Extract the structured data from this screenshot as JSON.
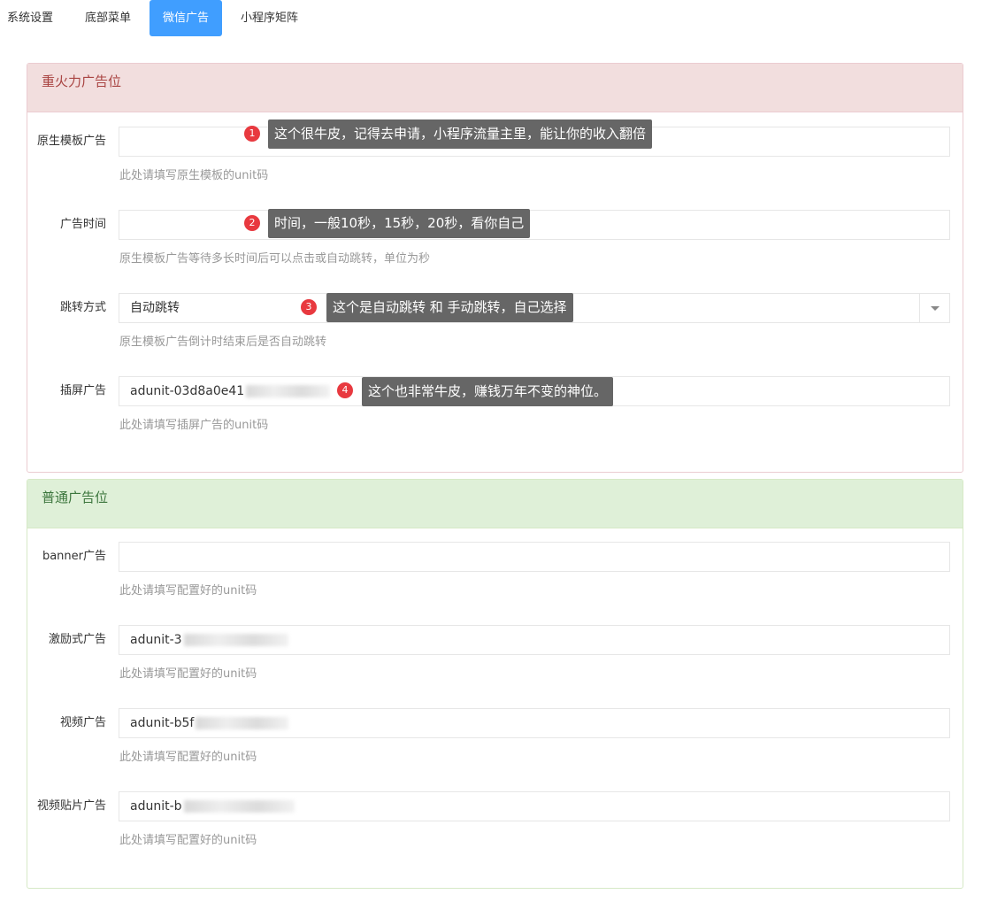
{
  "tabs": [
    {
      "label": "系统设置"
    },
    {
      "label": "底部菜单"
    },
    {
      "label": "微信广告",
      "active": true
    },
    {
      "label": "小程序矩阵"
    }
  ],
  "colors": {
    "tab_active": "#409eff",
    "tip_bg": "#666666",
    "badge": "#e8393f"
  },
  "panel_heavy": {
    "title": "重火力广告位",
    "fields": [
      {
        "label": "原生模板广告",
        "value": "",
        "help": "此处请填写原生模板的unit码"
      },
      {
        "label": "广告时间",
        "value": "",
        "help": "原生模板广告等待多长时间后可以点击或自动跳转，单位为秒"
      },
      {
        "label": "跳转方式",
        "value": "自动跳转",
        "help": "原生模板广告倒计时结束后是否自动跳转"
      },
      {
        "label": "插屏广告",
        "value": "adunit-03d8a0e41",
        "help": "此处请填写插屏广告的unit码"
      }
    ]
  },
  "panel_normal": {
    "title": "普通广告位",
    "fields": [
      {
        "label": "banner广告",
        "value": "",
        "help": "此处请填写配置好的unit码"
      },
      {
        "label": "激励式广告",
        "value": "adunit-3",
        "help": "此处请填写配置好的unit码"
      },
      {
        "label": "视频广告",
        "value": "adunit-b5f",
        "help": "此处请填写配置好的unit码"
      },
      {
        "label": "视频贴片广告",
        "value": "adunit-b",
        "help": "此处请填写配置好的unit码"
      }
    ]
  },
  "annotations": [
    {
      "number": "1",
      "text": "这个很牛皮，记得去申请，小程序流量主里，能让你的收入翻倍"
    },
    {
      "number": "2",
      "text": "时间，一般10秒，15秒，20秒，看你自己"
    },
    {
      "number": "3",
      "text": "这个是自动跳转 和 手动跳转，自己选择"
    },
    {
      "number": "4",
      "text": "这个也非常牛皮，赚钱万年不变的神位。"
    }
  ]
}
